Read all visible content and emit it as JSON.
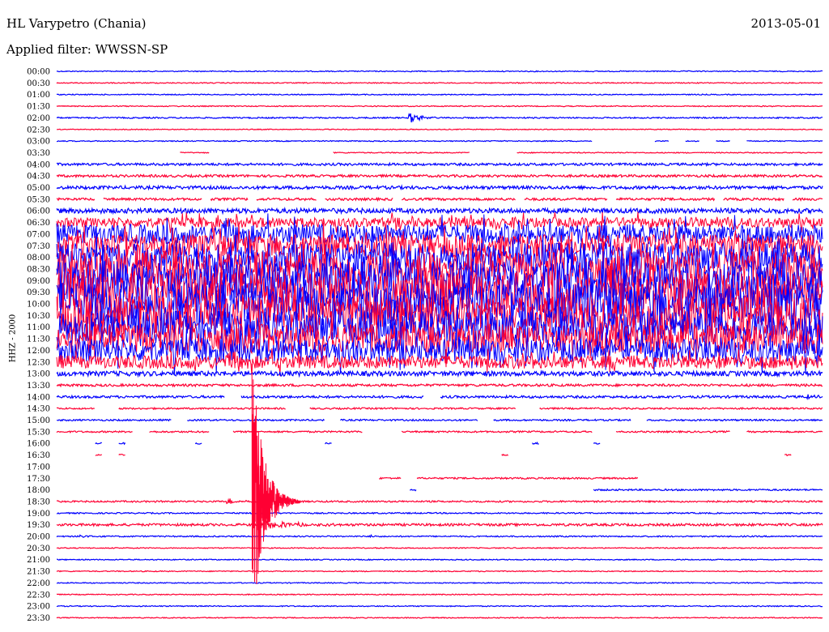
{
  "header": {
    "station": "HL Varypetro (Chania)",
    "date": "2013-05-01",
    "filter": "Applied filter: WWSSN-SP"
  },
  "chart_data": {
    "type": "line",
    "title": "HL Varypetro (Chania)",
    "subtitle": "Applied filter: WWSSN-SP",
    "ylabel": "HHZ - 2000",
    "time_labels": [
      "00:00",
      "00:30",
      "01:00",
      "01:30",
      "02:00",
      "02:30",
      "03:00",
      "03:30",
      "04:00",
      "04:30",
      "05:00",
      "05:30",
      "06:00",
      "06:30",
      "07:00",
      "07:30",
      "08:00",
      "08:30",
      "09:00",
      "09:30",
      "10:00",
      "10:30",
      "11:00",
      "11:30",
      "12:00",
      "12:30",
      "13:00",
      "13:30",
      "14:00",
      "14:30",
      "15:00",
      "15:30",
      "16:00",
      "16:30",
      "17:00",
      "17:30",
      "18:00",
      "18:30",
      "19:00",
      "19:30",
      "20:00",
      "20:30",
      "21:00",
      "21:30",
      "22:00",
      "22:30",
      "23:00",
      "23:30"
    ],
    "series_colors": [
      "#0000ff",
      "#ff0033"
    ],
    "traces": [
      {
        "label": "00:00",
        "noise": 0.6,
        "gaps": []
      },
      {
        "label": "00:30",
        "noise": 0.6,
        "gaps": []
      },
      {
        "label": "01:00",
        "noise": 0.6,
        "gaps": []
      },
      {
        "label": "01:30",
        "noise": 0.6,
        "gaps": []
      },
      {
        "label": "02:00",
        "noise": 0.8,
        "gaps": [],
        "events": [
          {
            "at": 0.46,
            "amp": 7,
            "dur": 0.035
          }
        ]
      },
      {
        "label": "02:30",
        "noise": 0.5,
        "gaps": []
      },
      {
        "label": "03:00",
        "noise": 0.6,
        "gaps": [
          [
            0.7,
            0.78
          ],
          [
            0.8,
            0.82
          ],
          [
            0.84,
            0.86
          ],
          [
            0.88,
            0.9
          ]
        ]
      },
      {
        "label": "03:30",
        "noise": 0.6,
        "gaps": [
          [
            0,
            0.16
          ],
          [
            0.2,
            0.36
          ],
          [
            0.54,
            0.6
          ]
        ]
      },
      {
        "label": "04:00",
        "noise": 1.5,
        "gaps": []
      },
      {
        "label": "04:30",
        "noise": 1.5,
        "gaps": []
      },
      {
        "label": "05:00",
        "noise": 2,
        "gaps": []
      },
      {
        "label": "05:30",
        "noise": 1.5,
        "gaps": [
          [
            0.05,
            0.06
          ],
          [
            0.19,
            0.2
          ],
          [
            0.25,
            0.26
          ],
          [
            0.34,
            0.35
          ],
          [
            0.44,
            0.45
          ],
          [
            0.6,
            0.61
          ],
          [
            0.72,
            0.73
          ],
          [
            0.86,
            0.87
          ],
          [
            0.95,
            0.96
          ]
        ]
      },
      {
        "label": "06:00",
        "noise": 3,
        "gaps": []
      },
      {
        "label": "06:30",
        "noise": 6,
        "gaps": []
      },
      {
        "label": "07:00",
        "noise": 12,
        "gaps": []
      },
      {
        "label": "07:30",
        "noise": 14,
        "gaps": []
      },
      {
        "label": "08:00",
        "noise": 18,
        "gaps": []
      },
      {
        "label": "08:30",
        "noise": 22,
        "gaps": []
      },
      {
        "label": "09:00",
        "noise": 24,
        "gaps": []
      },
      {
        "label": "09:30",
        "noise": 24,
        "gaps": []
      },
      {
        "label": "10:00",
        "noise": 26,
        "gaps": []
      },
      {
        "label": "10:30",
        "noise": 24,
        "gaps": []
      },
      {
        "label": "11:00",
        "noise": 20,
        "gaps": []
      },
      {
        "label": "11:30",
        "noise": 18,
        "gaps": []
      },
      {
        "label": "12:00",
        "noise": 14,
        "gaps": []
      },
      {
        "label": "12:30",
        "noise": 8,
        "gaps": []
      },
      {
        "label": "13:00",
        "noise": 3,
        "gaps": []
      },
      {
        "label": "13:30",
        "noise": 1.5,
        "gaps": []
      },
      {
        "label": "14:00",
        "noise": 1.5,
        "gaps": [
          [
            0.22,
            0.24
          ],
          [
            0.48,
            0.5
          ]
        ],
        "events": [
          {
            "at": 0.98,
            "amp": 6,
            "dur": 0.02
          }
        ]
      },
      {
        "label": "14:30",
        "noise": 1,
        "gaps": [
          [
            0.05,
            0.08
          ],
          [
            0.3,
            0.33
          ],
          [
            0.6,
            0.63
          ]
        ]
      },
      {
        "label": "15:00",
        "noise": 1,
        "gaps": [
          [
            0.15,
            0.17
          ],
          [
            0.35,
            0.37
          ],
          [
            0.55,
            0.57
          ],
          [
            0.75,
            0.77
          ]
        ]
      },
      {
        "label": "15:30",
        "noise": 1,
        "gaps": [
          [
            0.1,
            0.12
          ],
          [
            0.2,
            0.23
          ],
          [
            0.4,
            0.45
          ],
          [
            0.7,
            0.73
          ],
          [
            0.88,
            0.9
          ]
        ]
      },
      {
        "label": "16:00",
        "noise": 1,
        "gaps": [
          [
            0,
            0.05
          ],
          [
            0.06,
            0.08
          ],
          [
            0.09,
            0.18
          ],
          [
            0.19,
            0.35
          ],
          [
            0.36,
            0.62
          ],
          [
            0.63,
            0.7
          ],
          [
            0.71,
            1
          ]
        ]
      },
      {
        "label": "16:30",
        "noise": 1,
        "gaps": [
          [
            0,
            0.05
          ],
          [
            0.06,
            0.08
          ],
          [
            0.09,
            0.58
          ],
          [
            0.59,
            0.95
          ],
          [
            0.96,
            1
          ]
        ]
      },
      {
        "label": "17:00",
        "noise": 0,
        "gaps": [
          [
            0,
            1
          ]
        ]
      },
      {
        "label": "17:30",
        "noise": 1,
        "gaps": [
          [
            0,
            0.42
          ],
          [
            0.45,
            0.47
          ],
          [
            0.76,
            1
          ]
        ]
      },
      {
        "label": "18:00",
        "noise": 1,
        "gaps": [
          [
            0,
            0.46
          ],
          [
            0.47,
            0.7
          ]
        ]
      },
      {
        "label": "18:30",
        "noise": 1,
        "gaps": [],
        "events": [
          {
            "at": 0.22,
            "amp": 6,
            "dur": 0.03
          }
        ]
      },
      {
        "label": "19:00",
        "noise": 0.8,
        "gaps": []
      },
      {
        "label": "19:30",
        "noise": 1.5,
        "gaps": [],
        "events": [
          {
            "at": 0.27,
            "amp": 6,
            "dur": 0.1
          }
        ]
      },
      {
        "label": "20:00",
        "noise": 0.8,
        "gaps": [],
        "events": [
          {
            "at": 0.03,
            "amp": 3,
            "dur": 0.02
          },
          {
            "at": 0.41,
            "amp": 2,
            "dur": 0.01
          }
        ]
      },
      {
        "label": "20:30",
        "noise": 0.6,
        "gaps": []
      },
      {
        "label": "21:00",
        "noise": 0.6,
        "gaps": []
      },
      {
        "label": "21:30",
        "noise": 0.6,
        "gaps": []
      },
      {
        "label": "22:00",
        "noise": 0.6,
        "gaps": []
      },
      {
        "label": "22:30",
        "noise": 0.6,
        "gaps": []
      },
      {
        "label": "23:00",
        "noise": 0.6,
        "gaps": []
      },
      {
        "label": "23:30",
        "noise": 0.6,
        "gaps": []
      }
    ],
    "main_event": {
      "label": "18:30",
      "at": 0.255,
      "peak_amp": 180
    }
  }
}
